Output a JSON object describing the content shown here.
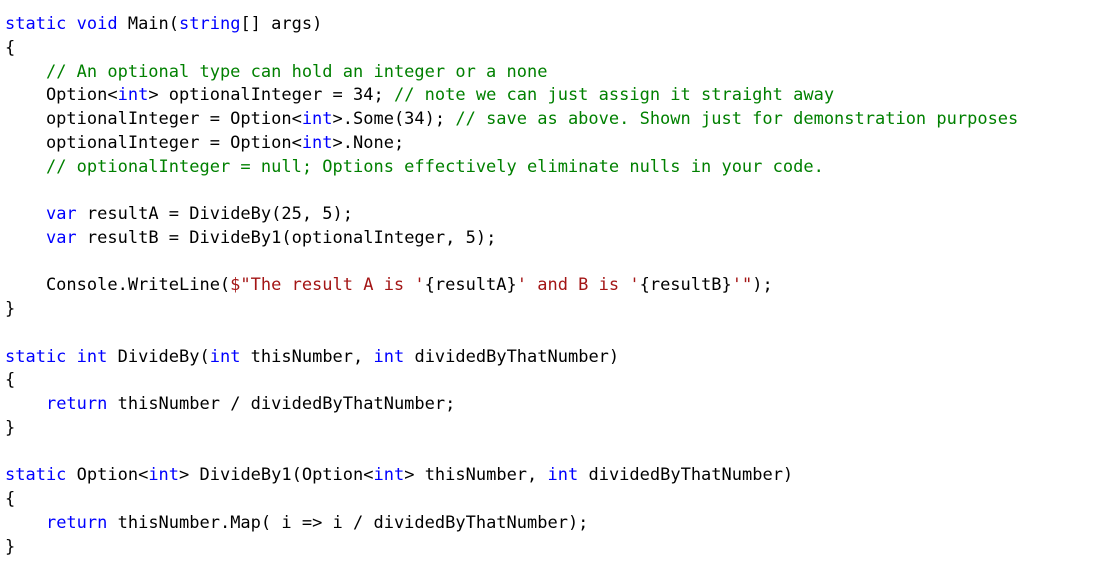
{
  "colors": {
    "keyword": "#0000ff",
    "comment": "#008000",
    "string": "#a31515",
    "text": "#000000",
    "background": "#ffffff"
  },
  "lines": [
    [
      [
        "kw",
        "static void "
      ],
      [
        "tx",
        "Main("
      ],
      [
        "kw",
        "string"
      ],
      [
        "tx",
        "[] args)"
      ]
    ],
    [
      [
        "tx",
        "{"
      ]
    ],
    [
      [
        "tx",
        "    "
      ],
      [
        "cm",
        "// An optional type can hold an integer or a none"
      ]
    ],
    [
      [
        "tx",
        "    Option<"
      ],
      [
        "kw",
        "int"
      ],
      [
        "tx",
        "> optionalInteger = 34; "
      ],
      [
        "cm",
        "// note we can just assign it straight away"
      ]
    ],
    [
      [
        "tx",
        "    optionalInteger = Option<"
      ],
      [
        "kw",
        "int"
      ],
      [
        "tx",
        ">.Some(34); "
      ],
      [
        "cm",
        "// save as above. Shown just for demonstration purposes"
      ]
    ],
    [
      [
        "tx",
        "    optionalInteger = Option<"
      ],
      [
        "kw",
        "int"
      ],
      [
        "tx",
        ">.None;"
      ]
    ],
    [
      [
        "tx",
        "    "
      ],
      [
        "cm",
        "// optionalInteger = null; Options effectively eliminate nulls in your code."
      ]
    ],
    [],
    [
      [
        "tx",
        "    "
      ],
      [
        "kw",
        "var"
      ],
      [
        "tx",
        " resultA = DivideBy(25, 5);"
      ]
    ],
    [
      [
        "tx",
        "    "
      ],
      [
        "kw",
        "var"
      ],
      [
        "tx",
        " resultB = DivideBy1(optionalInteger, 5);"
      ]
    ],
    [],
    [
      [
        "tx",
        "    Console.WriteLine("
      ],
      [
        "st",
        "$\"The result A is '"
      ],
      [
        "tx",
        "{resultA}"
      ],
      [
        "st",
        "' and B is '"
      ],
      [
        "tx",
        "{resultB}"
      ],
      [
        "st",
        "'\""
      ],
      [
        "tx",
        ");"
      ]
    ],
    [
      [
        "tx",
        "}"
      ]
    ],
    [],
    [
      [
        "kw",
        "static int "
      ],
      [
        "tx",
        "DivideBy("
      ],
      [
        "kw",
        "int"
      ],
      [
        "tx",
        " thisNumber, "
      ],
      [
        "kw",
        "int"
      ],
      [
        "tx",
        " dividedByThatNumber)"
      ]
    ],
    [
      [
        "tx",
        "{"
      ]
    ],
    [
      [
        "tx",
        "    "
      ],
      [
        "kw",
        "return"
      ],
      [
        "tx",
        " thisNumber / dividedByThatNumber;"
      ]
    ],
    [
      [
        "tx",
        "}"
      ]
    ],
    [],
    [
      [
        "kw",
        "static "
      ],
      [
        "tx",
        "Option<"
      ],
      [
        "kw",
        "int"
      ],
      [
        "tx",
        "> DivideBy1(Option<"
      ],
      [
        "kw",
        "int"
      ],
      [
        "tx",
        "> thisNumber, "
      ],
      [
        "kw",
        "int"
      ],
      [
        "tx",
        " dividedByThatNumber)"
      ]
    ],
    [
      [
        "tx",
        "{"
      ]
    ],
    [
      [
        "tx",
        "    "
      ],
      [
        "kw",
        "return"
      ],
      [
        "tx",
        " thisNumber.Map( i => i / dividedByThatNumber);"
      ]
    ],
    [
      [
        "tx",
        "}"
      ]
    ]
  ]
}
